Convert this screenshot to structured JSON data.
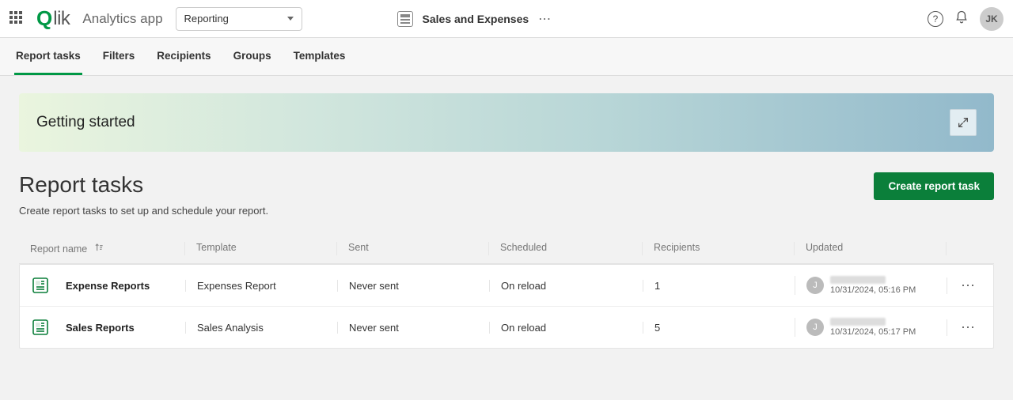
{
  "header": {
    "logo_q": "Q",
    "logo_rest": "lik",
    "app_name": "Analytics app",
    "dropdown_value": "Reporting",
    "sheet_title": "Sales and Expenses",
    "avatar_initials": "JK"
  },
  "tabs": [
    {
      "label": "Report tasks",
      "active": true
    },
    {
      "label": "Filters",
      "active": false
    },
    {
      "label": "Recipients",
      "active": false
    },
    {
      "label": "Groups",
      "active": false
    },
    {
      "label": "Templates",
      "active": false
    }
  ],
  "banner": {
    "title": "Getting started"
  },
  "page": {
    "title": "Report tasks",
    "subtitle": "Create report tasks to set up and schedule your report.",
    "create_button": "Create report task"
  },
  "table": {
    "columns": {
      "name": "Report name",
      "template": "Template",
      "sent": "Sent",
      "scheduled": "Scheduled",
      "recipients": "Recipients",
      "updated": "Updated"
    },
    "rows": [
      {
        "name": "Expense Reports",
        "template": "Expenses Report",
        "sent": "Never sent",
        "scheduled": "On reload",
        "recipients": "1",
        "updated_user_initial": "J",
        "updated_time": "10/31/2024, 05:16 PM"
      },
      {
        "name": "Sales Reports",
        "template": "Sales Analysis",
        "sent": "Never sent",
        "scheduled": "On reload",
        "recipients": "5",
        "updated_user_initial": "J",
        "updated_time": "10/31/2024, 05:17 PM"
      }
    ]
  },
  "colors": {
    "brand_green": "#009845",
    "button_green": "#0b7f3a"
  }
}
